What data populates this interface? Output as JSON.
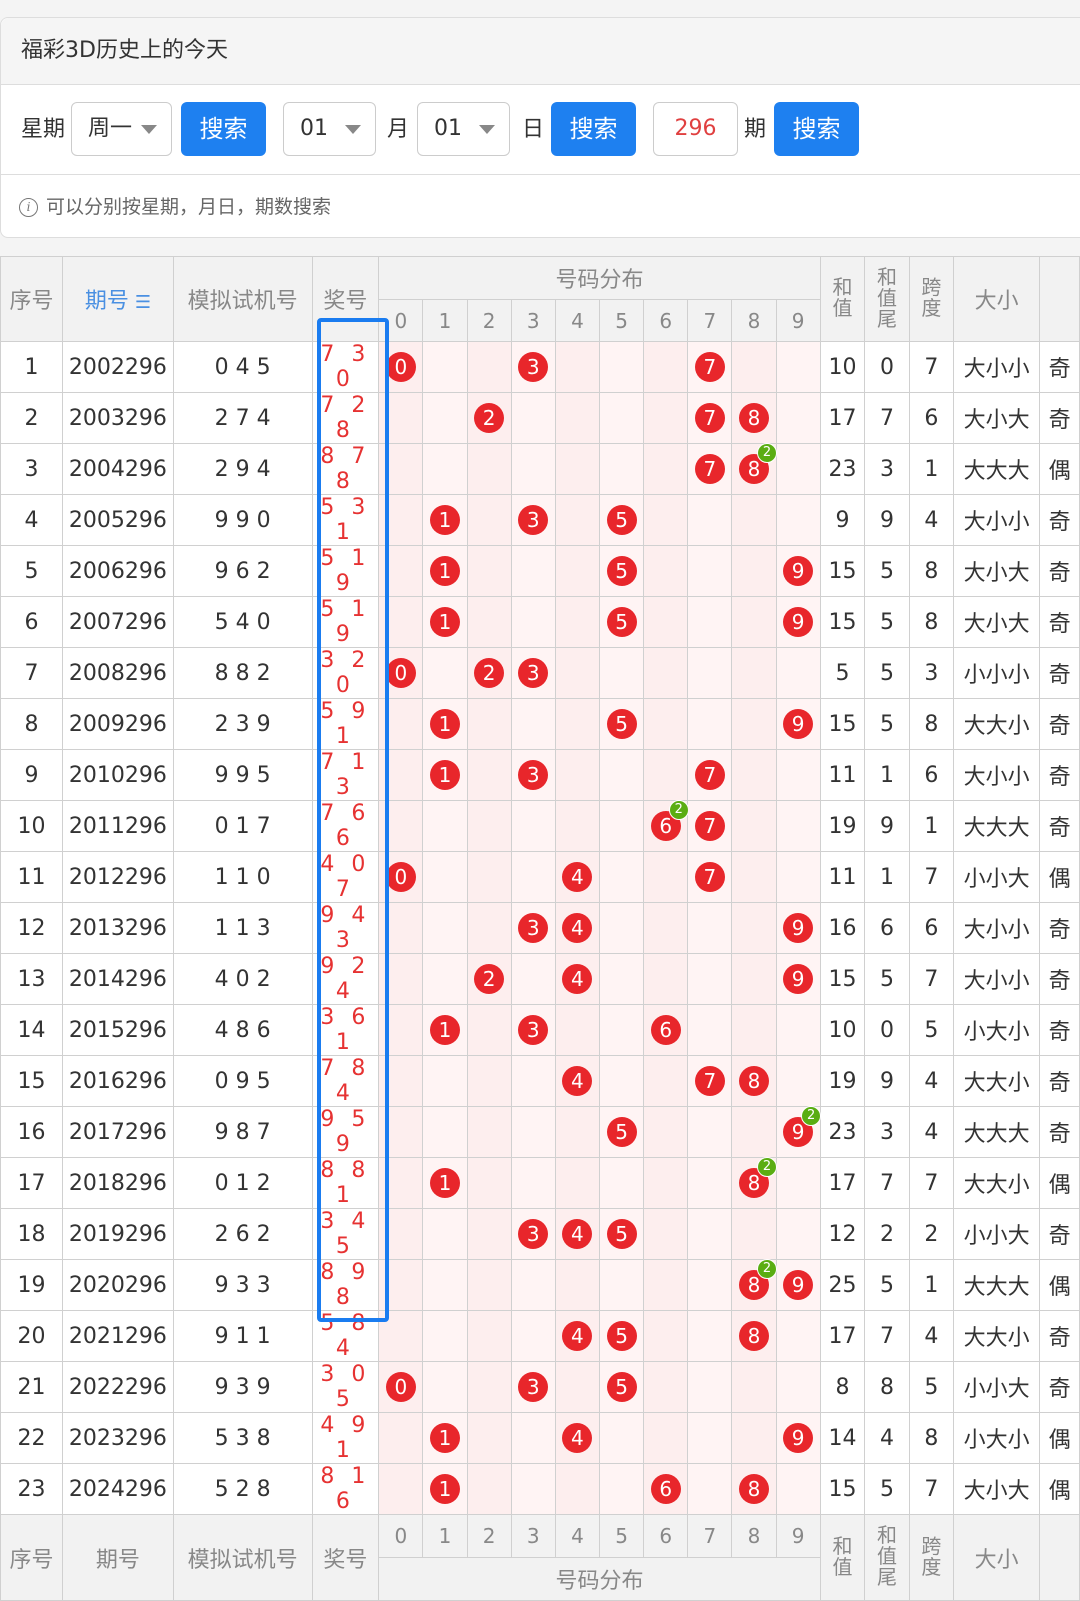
{
  "header": {
    "title": "福彩3D历史上的今天"
  },
  "search": {
    "weekday_label": "星期",
    "weekday_value": "周一",
    "search_label": "搜索",
    "month_value": "01",
    "month_label": "月",
    "day_value": "01",
    "day_label": "日",
    "issue_value": "296",
    "issue_label": "期",
    "hint": "可以分别按星期，月日，期数搜索"
  },
  "table": {
    "headers": {
      "index": "序号",
      "issue": "期号",
      "trial": "模拟试机号",
      "winning": "奖号",
      "distribution": "号码分布",
      "sum": "和值",
      "sum_tail": "和值尾",
      "span": "跨度",
      "size": "大小"
    },
    "digits": [
      "0",
      "1",
      "2",
      "3",
      "4",
      "5",
      "6",
      "7",
      "8",
      "9"
    ],
    "rows": [
      {
        "idx": "1",
        "issue": "2002296",
        "trial": "0 4 5",
        "win": "7 3 0",
        "nums": [
          7,
          3,
          0
        ],
        "sum": "10",
        "tail": "0",
        "span": "7",
        "size": "大小小",
        "rest": "奇"
      },
      {
        "idx": "2",
        "issue": "2003296",
        "trial": "2 7 4",
        "win": "7 2 8",
        "nums": [
          7,
          2,
          8
        ],
        "sum": "17",
        "tail": "7",
        "span": "6",
        "size": "大小大",
        "rest": "奇"
      },
      {
        "idx": "3",
        "issue": "2004296",
        "trial": "2 9 4",
        "win": "8 7 8",
        "nums": [
          8,
          7,
          8
        ],
        "sum": "23",
        "tail": "3",
        "span": "1",
        "size": "大大大",
        "rest": "偶"
      },
      {
        "idx": "4",
        "issue": "2005296",
        "trial": "9 9 0",
        "win": "5 3 1",
        "nums": [
          5,
          3,
          1
        ],
        "sum": "9",
        "tail": "9",
        "span": "4",
        "size": "大小小",
        "rest": "奇"
      },
      {
        "idx": "5",
        "issue": "2006296",
        "trial": "9 6 2",
        "win": "5 1 9",
        "nums": [
          5,
          1,
          9
        ],
        "sum": "15",
        "tail": "5",
        "span": "8",
        "size": "大小大",
        "rest": "奇"
      },
      {
        "idx": "6",
        "issue": "2007296",
        "trial": "5 4 0",
        "win": "5 1 9",
        "nums": [
          5,
          1,
          9
        ],
        "sum": "15",
        "tail": "5",
        "span": "8",
        "size": "大小大",
        "rest": "奇"
      },
      {
        "idx": "7",
        "issue": "2008296",
        "trial": "8 8 2",
        "win": "3 2 0",
        "nums": [
          3,
          2,
          0
        ],
        "sum": "5",
        "tail": "5",
        "span": "3",
        "size": "小小小",
        "rest": "奇"
      },
      {
        "idx": "8",
        "issue": "2009296",
        "trial": "2 3 9",
        "win": "5 9 1",
        "nums": [
          5,
          9,
          1
        ],
        "sum": "15",
        "tail": "5",
        "span": "8",
        "size": "大大小",
        "rest": "奇"
      },
      {
        "idx": "9",
        "issue": "2010296",
        "trial": "9 9 5",
        "win": "7 1 3",
        "nums": [
          7,
          1,
          3
        ],
        "sum": "11",
        "tail": "1",
        "span": "6",
        "size": "大小小",
        "rest": "奇"
      },
      {
        "idx": "10",
        "issue": "2011296",
        "trial": "0 1 7",
        "win": "7 6 6",
        "nums": [
          7,
          6,
          6
        ],
        "sum": "19",
        "tail": "9",
        "span": "1",
        "size": "大大大",
        "rest": "奇"
      },
      {
        "idx": "11",
        "issue": "2012296",
        "trial": "1 1 0",
        "win": "4 0 7",
        "nums": [
          4,
          0,
          7
        ],
        "sum": "11",
        "tail": "1",
        "span": "7",
        "size": "小小大",
        "rest": "偶"
      },
      {
        "idx": "12",
        "issue": "2013296",
        "trial": "1 1 3",
        "win": "9 4 3",
        "nums": [
          9,
          4,
          3
        ],
        "sum": "16",
        "tail": "6",
        "span": "6",
        "size": "大小小",
        "rest": "奇"
      },
      {
        "idx": "13",
        "issue": "2014296",
        "trial": "4 0 2",
        "win": "9 2 4",
        "nums": [
          9,
          2,
          4
        ],
        "sum": "15",
        "tail": "5",
        "span": "7",
        "size": "大小小",
        "rest": "奇"
      },
      {
        "idx": "14",
        "issue": "2015296",
        "trial": "4 8 6",
        "win": "3 6 1",
        "nums": [
          3,
          6,
          1
        ],
        "sum": "10",
        "tail": "0",
        "span": "5",
        "size": "小大小",
        "rest": "奇"
      },
      {
        "idx": "15",
        "issue": "2016296",
        "trial": "0 9 5",
        "win": "7 8 4",
        "nums": [
          7,
          8,
          4
        ],
        "sum": "19",
        "tail": "9",
        "span": "4",
        "size": "大大小",
        "rest": "奇"
      },
      {
        "idx": "16",
        "issue": "2017296",
        "trial": "9 8 7",
        "win": "9 5 9",
        "nums": [
          9,
          5,
          9
        ],
        "sum": "23",
        "tail": "3",
        "span": "4",
        "size": "大大大",
        "rest": "奇"
      },
      {
        "idx": "17",
        "issue": "2018296",
        "trial": "0 1 2",
        "win": "8 8 1",
        "nums": [
          8,
          8,
          1
        ],
        "sum": "17",
        "tail": "7",
        "span": "7",
        "size": "大大小",
        "rest": "偶"
      },
      {
        "idx": "18",
        "issue": "2019296",
        "trial": "2 6 2",
        "win": "3 4 5",
        "nums": [
          3,
          4,
          5
        ],
        "sum": "12",
        "tail": "2",
        "span": "2",
        "size": "小小大",
        "rest": "奇"
      },
      {
        "idx": "19",
        "issue": "2020296",
        "trial": "9 3 3",
        "win": "8 9 8",
        "nums": [
          8,
          9,
          8
        ],
        "sum": "25",
        "tail": "5",
        "span": "1",
        "size": "大大大",
        "rest": "偶"
      },
      {
        "idx": "20",
        "issue": "2021296",
        "trial": "9 1 1",
        "win": "5 8 4",
        "nums": [
          5,
          8,
          4
        ],
        "sum": "17",
        "tail": "7",
        "span": "4",
        "size": "大大小",
        "rest": "奇"
      },
      {
        "idx": "21",
        "issue": "2022296",
        "trial": "9 3 9",
        "win": "3 0 5",
        "nums": [
          3,
          0,
          5
        ],
        "sum": "8",
        "tail": "8",
        "span": "5",
        "size": "小小大",
        "rest": "奇"
      },
      {
        "idx": "22",
        "issue": "2023296",
        "trial": "5 3 8",
        "win": "4 9 1",
        "nums": [
          4,
          9,
          1
        ],
        "sum": "14",
        "tail": "4",
        "span": "8",
        "size": "小大小",
        "rest": "偶"
      },
      {
        "idx": "23",
        "issue": "2024296",
        "trial": "5 2 8",
        "win": "8 1 6",
        "nums": [
          8,
          1,
          6
        ],
        "sum": "15",
        "tail": "5",
        "span": "7",
        "size": "大小大",
        "rest": "偶"
      }
    ]
  }
}
